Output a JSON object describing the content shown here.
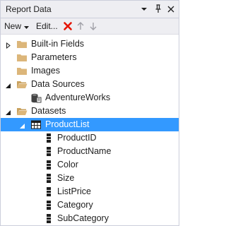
{
  "panel": {
    "title": "Report Data",
    "dropdown_icon": "chevron-down-icon",
    "pin_icon": "pin-icon",
    "close_icon": "close-icon"
  },
  "toolbar": {
    "new_label": "New",
    "edit_label": "Edit...",
    "delete_icon": "delete-icon",
    "move_up_icon": "arrow-up-icon",
    "move_down_icon": "arrow-down-icon",
    "delete_color": "#e51400"
  },
  "colors": {
    "selection": "#3399ff",
    "folder": "#dcb67a",
    "tab_bg": "#eeeef2"
  },
  "tree": {
    "built_in_fields": "Built-in Fields",
    "parameters": "Parameters",
    "images": "Images",
    "data_sources": "Data Sources",
    "adventureworks": "AdventureWorks",
    "datasets": "Datasets",
    "productlist": "ProductList",
    "fields": [
      "ProductID",
      "ProductName",
      "Color",
      "Size",
      "ListPrice",
      "Category",
      "SubCategory"
    ]
  }
}
